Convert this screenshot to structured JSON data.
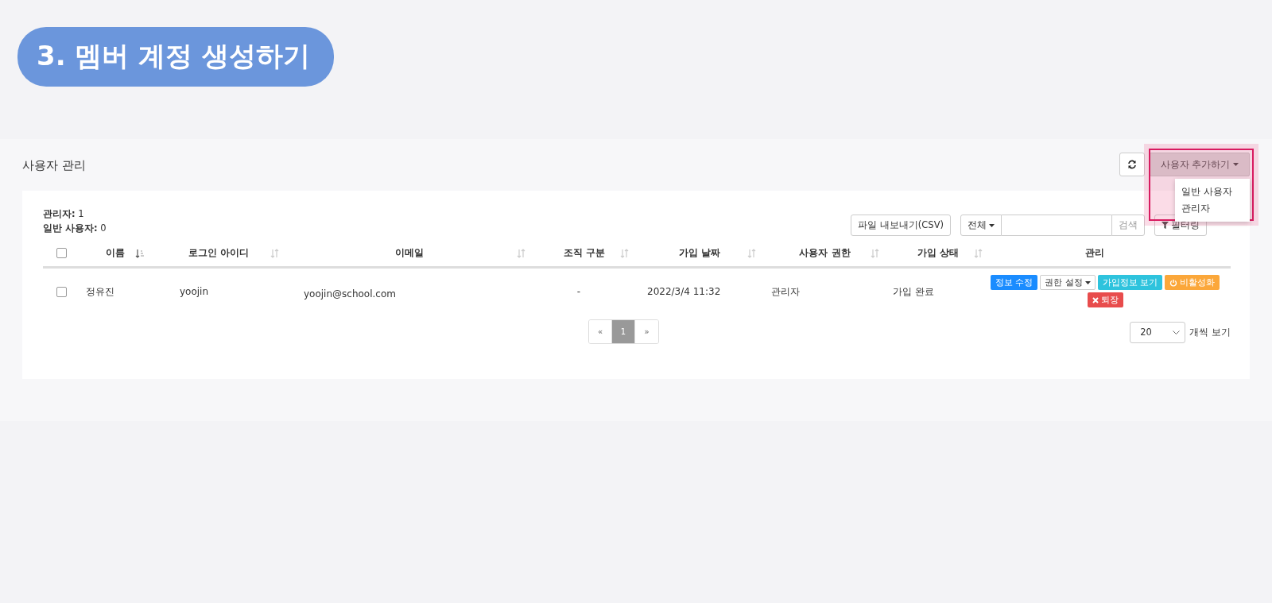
{
  "banner": {
    "title": "3. 멤버 계정 생성하기"
  },
  "header": {
    "title": "사용자 관리",
    "add_button": {
      "label": "사용자 추가하기",
      "expanded": true,
      "highlighted": true
    },
    "add_menu": [
      "일반 사용자",
      "관리자"
    ]
  },
  "summary": [
    {
      "label": "관리자:",
      "value": "1"
    },
    {
      "label": "일반 사용자:",
      "value": "0"
    }
  ],
  "toolbar": {
    "export_label": "파일 내보내기(CSV)",
    "scope": "전체",
    "search_button": "검색",
    "filter_button": "필터링"
  },
  "table": {
    "all_checked": false,
    "columns": [
      {
        "label": "이름",
        "sortable": true,
        "sorted": true
      },
      {
        "label": "로그인 아이디",
        "sortable": true,
        "sorted": false
      },
      {
        "label": "이메일",
        "sortable": true,
        "sorted": false
      },
      {
        "label": "조직 구분",
        "sortable": true,
        "sorted": false
      },
      {
        "label": "가입 날짜",
        "sortable": true,
        "sorted": false
      },
      {
        "label": "사용자 권한",
        "sortable": true,
        "sorted": false
      },
      {
        "label": "가입 상태",
        "sortable": true,
        "sorted": false
      },
      {
        "label": "관리"
      }
    ],
    "rows": [
      {
        "checked": false,
        "cells": [
          "정유진",
          "yoojin",
          "yoojin@school.com",
          "-",
          "2022/3/4 11:32",
          "관리자",
          "가입 완료"
        ],
        "actions": [
          {
            "kind": "primary",
            "label": "정보 수정"
          },
          {
            "kind": "dropdown",
            "label": "권한 설정"
          },
          {
            "kind": "info",
            "label": "가입정보 보기"
          },
          {
            "kind": "warning",
            "label": "비활성화"
          },
          {
            "kind": "danger",
            "label": "퇴장"
          }
        ]
      }
    ]
  },
  "pagination": [
    {
      "label": "«",
      "selected": false
    },
    {
      "label": "1",
      "selected": true
    },
    {
      "label": "»",
      "selected": false
    }
  ],
  "page_size": {
    "value": "20",
    "suffix": "개씩 보기"
  }
}
